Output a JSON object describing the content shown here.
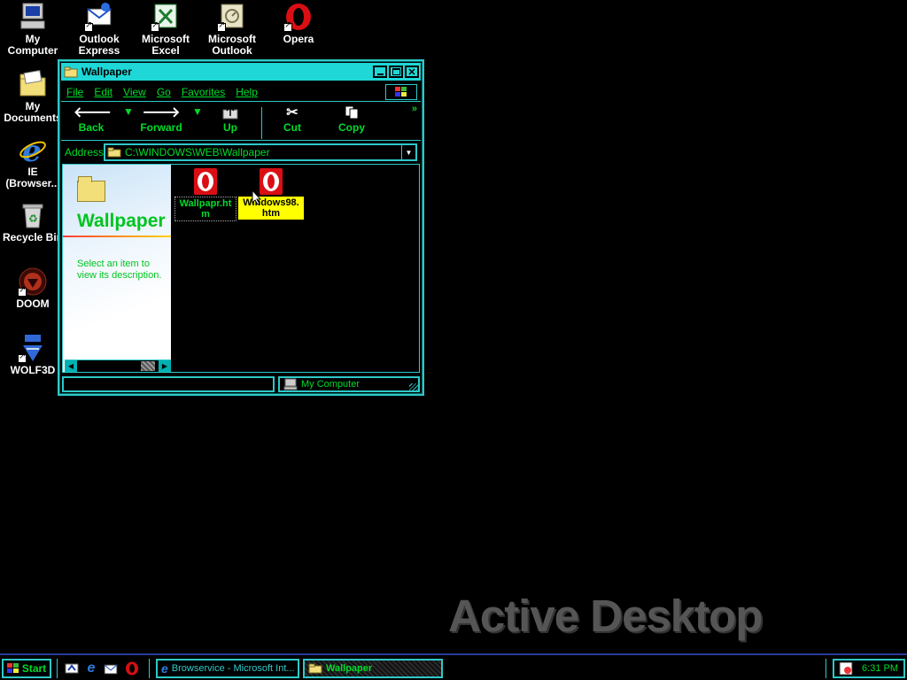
{
  "desktop": {
    "icons": [
      {
        "label": "My\nComputer"
      },
      {
        "label": "Outlook\nExpress"
      },
      {
        "label": "Microsoft\nExcel"
      },
      {
        "label": "Microsoft\nOutlook"
      },
      {
        "label": "Opera"
      },
      {
        "label": "My\nDocuments"
      },
      {
        "label": "IE\n(Browser..."
      },
      {
        "label": "Recycle Bin"
      },
      {
        "label": "DOOM"
      },
      {
        "label": "WOLF3D"
      }
    ],
    "watermark": "Active Desktop"
  },
  "window": {
    "title": "Wallpaper",
    "menu": [
      "File",
      "Edit",
      "View",
      "Go",
      "Favorites",
      "Help"
    ],
    "toolbar": {
      "back": "Back",
      "forward": "Forward",
      "up": "Up",
      "cut": "Cut",
      "copy": "Copy",
      "more": "»"
    },
    "address": {
      "label": "Address",
      "value": "C:\\WINDOWS\\WEB\\Wallpaper"
    },
    "left_panel": {
      "title": "Wallpaper",
      "description": "Select an item to view its description."
    },
    "files": [
      {
        "name": "Wallpapr.htm",
        "selected": false
      },
      {
        "name": "Windows98.htm",
        "selected": true
      }
    ],
    "status": {
      "left": "",
      "right": "My Computer"
    }
  },
  "taskbar": {
    "start": "Start",
    "tasks": [
      {
        "label": "Browservice - Microsoft Int..."
      },
      {
        "label": "Wallpaper"
      }
    ],
    "clock": "6:31 PM"
  },
  "colors": {
    "accent": "#1fd7d7",
    "text_green": "#00dc2a",
    "selection_yellow": "#ffff00",
    "opera_red": "#d90f14"
  }
}
